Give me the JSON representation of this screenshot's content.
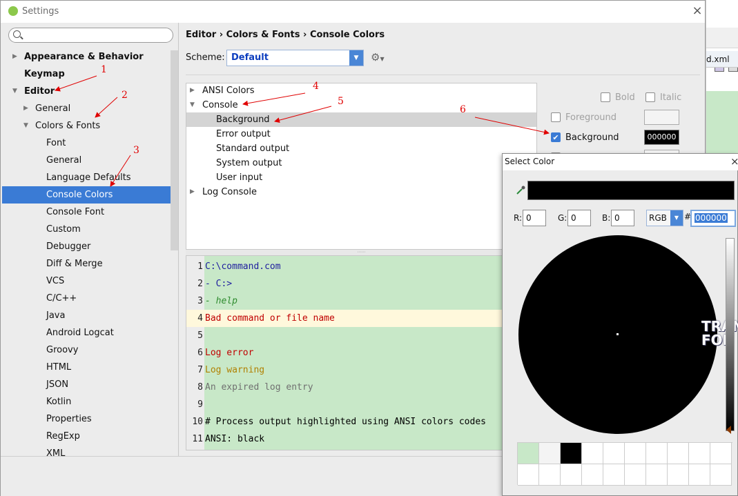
{
  "window": {
    "title": "Settings",
    "close_glyph": "×"
  },
  "ide_background": {
    "tab_label": "d.xml"
  },
  "search": {
    "placeholder": "",
    "value": ""
  },
  "sidebar": {
    "items": [
      {
        "label": "Appearance & Behavior",
        "indent": 0,
        "arrow": "▶",
        "bold": true
      },
      {
        "label": "Keymap",
        "indent": 0,
        "arrow": "",
        "bold": true
      },
      {
        "label": "Editor",
        "indent": 0,
        "arrow": "▼",
        "bold": true
      },
      {
        "label": "General",
        "indent": 1,
        "arrow": "▶",
        "bold": false
      },
      {
        "label": "Colors & Fonts",
        "indent": 1,
        "arrow": "▼",
        "bold": false
      },
      {
        "label": "Font",
        "indent": 2,
        "arrow": "",
        "bold": false
      },
      {
        "label": "General",
        "indent": 2,
        "arrow": "",
        "bold": false
      },
      {
        "label": "Language Defaults",
        "indent": 2,
        "arrow": "",
        "bold": false
      },
      {
        "label": "Console Colors",
        "indent": 2,
        "arrow": "",
        "bold": false,
        "selected": true
      },
      {
        "label": "Console Font",
        "indent": 2,
        "arrow": "",
        "bold": false
      },
      {
        "label": "Custom",
        "indent": 2,
        "arrow": "",
        "bold": false
      },
      {
        "label": "Debugger",
        "indent": 2,
        "arrow": "",
        "bold": false
      },
      {
        "label": "Diff & Merge",
        "indent": 2,
        "arrow": "",
        "bold": false
      },
      {
        "label": "VCS",
        "indent": 2,
        "arrow": "",
        "bold": false
      },
      {
        "label": "C/C++",
        "indent": 2,
        "arrow": "",
        "bold": false
      },
      {
        "label": "Java",
        "indent": 2,
        "arrow": "",
        "bold": false
      },
      {
        "label": "Android Logcat",
        "indent": 2,
        "arrow": "",
        "bold": false
      },
      {
        "label": "Groovy",
        "indent": 2,
        "arrow": "",
        "bold": false
      },
      {
        "label": "HTML",
        "indent": 2,
        "arrow": "",
        "bold": false
      },
      {
        "label": "JSON",
        "indent": 2,
        "arrow": "",
        "bold": false
      },
      {
        "label": "Kotlin",
        "indent": 2,
        "arrow": "",
        "bold": false
      },
      {
        "label": "Properties",
        "indent": 2,
        "arrow": "",
        "bold": false
      },
      {
        "label": "RegExp",
        "indent": 2,
        "arrow": "",
        "bold": false
      },
      {
        "label": "XML",
        "indent": 2,
        "arrow": "",
        "bold": false
      }
    ]
  },
  "breadcrumb": {
    "part1": "Editor",
    "part2": "Colors & Fonts",
    "part3": "Console Colors",
    "separator": "›"
  },
  "scheme": {
    "label": "Scheme:",
    "value": "Default",
    "gear_glyph": "⚙"
  },
  "attributes_tree": {
    "items": [
      {
        "label": "ANSI Colors",
        "indent": 0,
        "arrow": "▶"
      },
      {
        "label": "Console",
        "indent": 0,
        "arrow": "▼"
      },
      {
        "label": "Background",
        "indent": 1,
        "arrow": "",
        "selected": true
      },
      {
        "label": "Error output",
        "indent": 1,
        "arrow": ""
      },
      {
        "label": "Standard output",
        "indent": 1,
        "arrow": ""
      },
      {
        "label": "System output",
        "indent": 1,
        "arrow": ""
      },
      {
        "label": "User input",
        "indent": 1,
        "arrow": ""
      },
      {
        "label": "Log Console",
        "indent": 0,
        "arrow": "▶"
      }
    ]
  },
  "preview": {
    "lines": [
      {
        "num": "1",
        "text": "C:\\command.com",
        "color": "#1d1d9e",
        "italic": false
      },
      {
        "num": "2",
        "text": "- C:>",
        "color": "#1d1d9e",
        "italic": false
      },
      {
        "num": "3",
        "text": "- help",
        "color": "#2e8b2e",
        "italic": true
      },
      {
        "num": "4",
        "text": "Bad command or file name",
        "color": "#c00000",
        "italic": false,
        "current": true
      },
      {
        "num": "5",
        "text": "",
        "color": "#000000",
        "italic": false
      },
      {
        "num": "6",
        "text": "Log error",
        "color": "#c00000",
        "italic": false
      },
      {
        "num": "7",
        "text": "Log warning",
        "color": "#b08000",
        "italic": false
      },
      {
        "num": "8",
        "text": "An expired log entry",
        "color": "#707070",
        "italic": false
      },
      {
        "num": "9",
        "text": "",
        "color": "#000000",
        "italic": false
      },
      {
        "num": "10",
        "text": "# Process output highlighted using ANSI colors codes",
        "color": "#000000",
        "italic": false
      },
      {
        "num": "11",
        "text": "ANSI: black",
        "color": "#000000",
        "italic": false
      }
    ]
  },
  "options": {
    "bold_label": "Bold",
    "italic_label": "Italic",
    "foreground_label": "Foreground",
    "background_label": "Background",
    "background_value": "000000",
    "background_checked": true
  },
  "annotations": {
    "n1": "1",
    "n2": "2",
    "n3": "3",
    "n4": "4",
    "n5": "5",
    "n6": "6"
  },
  "color_dialog": {
    "title": "Select Color",
    "close_glyph": "×",
    "r_label": "R:",
    "r_value": "0",
    "g_label": "G:",
    "g_value": "0",
    "b_label": "B:",
    "b_value": "0",
    "mode_value": "RGB",
    "hash_label": "#",
    "hex_value": "000000",
    "wallpaper_text_1": "TRAN",
    "wallpaper_text_2": "FOR",
    "preview_color": "#000000",
    "recent_swatches": [
      "#c8e8c8",
      "#f4f4f4",
      "#000000",
      "#ffffff",
      "#ffffff",
      "#ffffff",
      "#ffffff",
      "#ffffff",
      "#ffffff",
      "#ffffff",
      "#ffffff",
      "#ffffff",
      "#ffffff",
      "#ffffff",
      "#ffffff",
      "#ffffff",
      "#ffffff",
      "#ffffff",
      "#ffffff",
      "#ffffff"
    ]
  },
  "colors": {
    "accent": "#3a7bd5",
    "preview_bg": "#c8e8c8",
    "annotation": "#e00000"
  }
}
